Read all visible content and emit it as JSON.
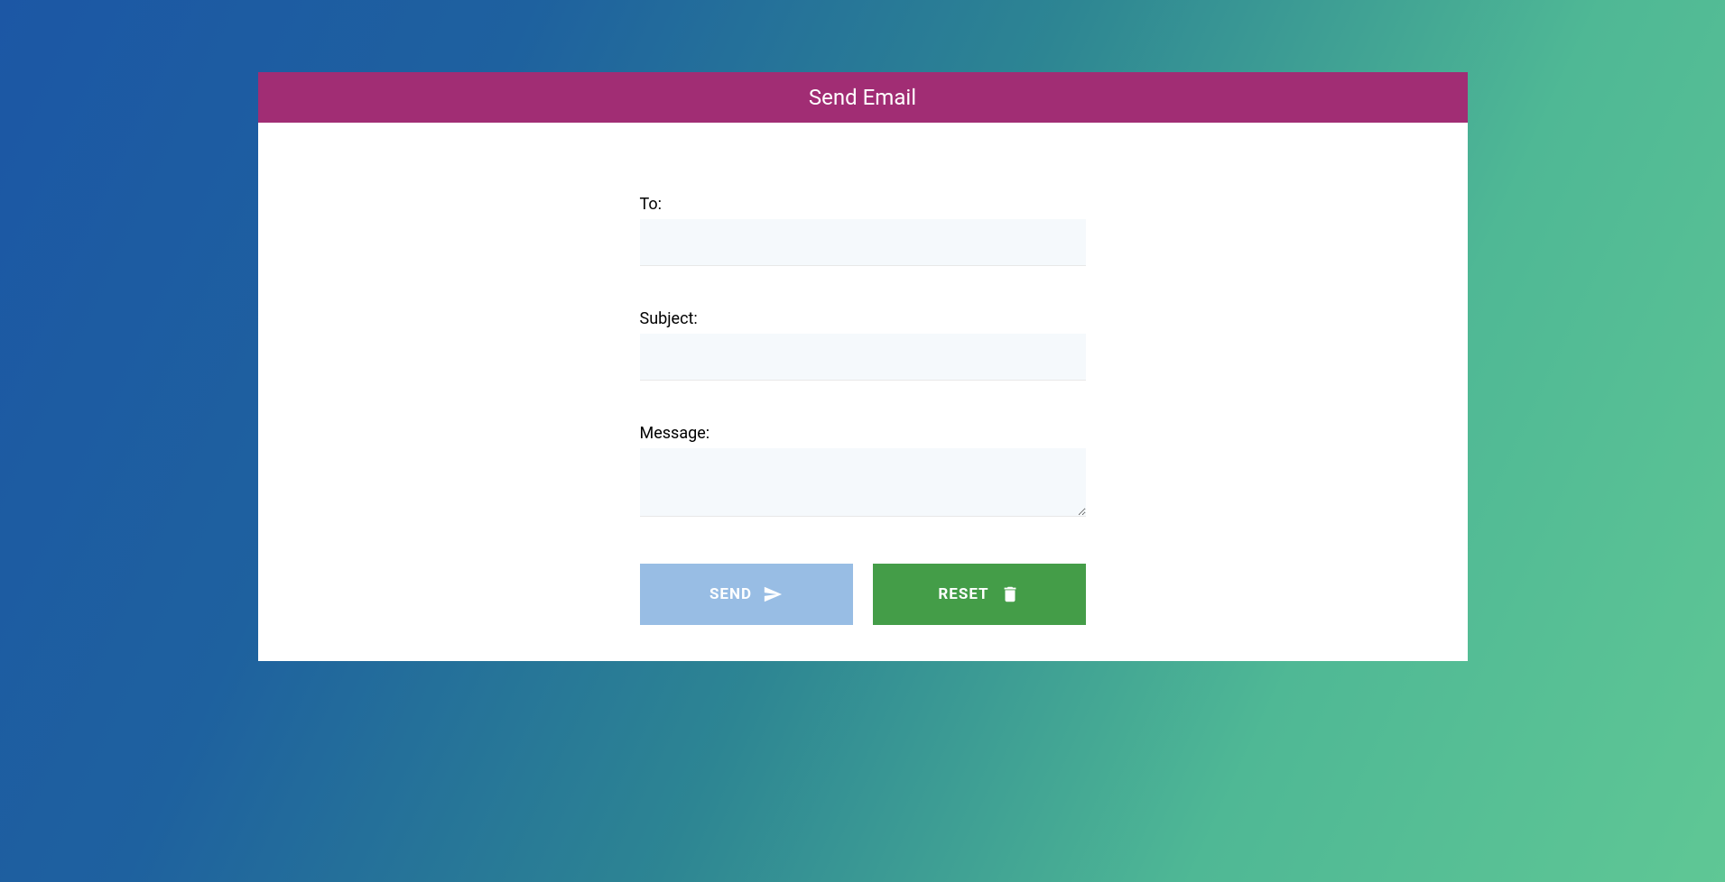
{
  "header": {
    "title": "Send Email"
  },
  "form": {
    "to": {
      "label": "To:",
      "value": ""
    },
    "subject": {
      "label": "Subject:",
      "value": ""
    },
    "message": {
      "label": "Message:",
      "value": ""
    }
  },
  "buttons": {
    "send": "SEND",
    "reset": "RESET"
  }
}
